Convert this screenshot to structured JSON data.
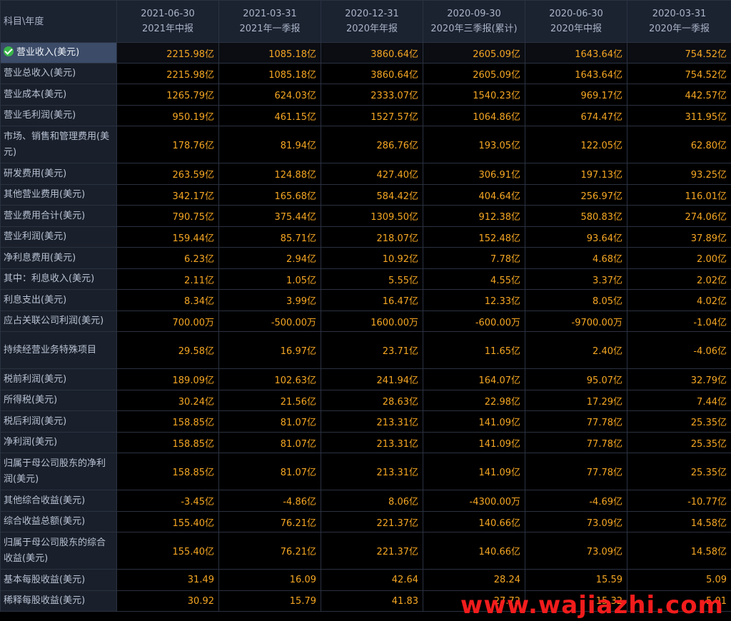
{
  "header": {
    "corner_label": "科目\\年度",
    "columns": [
      {
        "date": "2021-06-30",
        "period": "2021年中报"
      },
      {
        "date": "2021-03-31",
        "period": "2021年一季报"
      },
      {
        "date": "2020-12-31",
        "period": "2020年年报"
      },
      {
        "date": "2020-09-30",
        "period": "2020年三季报(累计)"
      },
      {
        "date": "2020-06-30",
        "period": "2020年中报"
      },
      {
        "date": "2020-03-31",
        "period": "2020年一季报"
      }
    ]
  },
  "rows": [
    {
      "label": "营业收入(美元)",
      "values": [
        "2215.98亿",
        "1085.18亿",
        "3860.64亿",
        "2605.09亿",
        "1643.64亿",
        "754.52亿"
      ]
    },
    {
      "label": "营业总收入(美元)",
      "values": [
        "2215.98亿",
        "1085.18亿",
        "3860.64亿",
        "2605.09亿",
        "1643.64亿",
        "754.52亿"
      ]
    },
    {
      "label": "营业成本(美元)",
      "values": [
        "1265.79亿",
        "624.03亿",
        "2333.07亿",
        "1540.23亿",
        "969.17亿",
        "442.57亿"
      ]
    },
    {
      "label": "营业毛利润(美元)",
      "values": [
        "950.19亿",
        "461.15亿",
        "1527.57亿",
        "1064.86亿",
        "674.47亿",
        "311.95亿"
      ]
    },
    {
      "label": "市场、销售和管理费用(美元)",
      "values": [
        "178.76亿",
        "81.94亿",
        "286.76亿",
        "193.05亿",
        "122.05亿",
        "62.80亿"
      ]
    },
    {
      "label": "研发费用(美元)",
      "values": [
        "263.59亿",
        "124.88亿",
        "427.40亿",
        "306.91亿",
        "197.13亿",
        "93.25亿"
      ]
    },
    {
      "label": "其他营业费用(美元)",
      "values": [
        "342.17亿",
        "165.68亿",
        "584.42亿",
        "404.64亿",
        "256.97亿",
        "116.01亿"
      ]
    },
    {
      "label": "营业费用合计(美元)",
      "values": [
        "790.75亿",
        "375.44亿",
        "1309.50亿",
        "912.38亿",
        "580.83亿",
        "274.06亿"
      ]
    },
    {
      "label": "营业利润(美元)",
      "values": [
        "159.44亿",
        "85.71亿",
        "218.07亿",
        "152.48亿",
        "93.64亿",
        "37.89亿"
      ]
    },
    {
      "label": "净利息费用(美元)",
      "values": [
        "6.23亿",
        "2.94亿",
        "10.92亿",
        "7.78亿",
        "4.68亿",
        "2.00亿"
      ]
    },
    {
      "label": "其中：利息收入(美元)",
      "values": [
        "2.11亿",
        "1.05亿",
        "5.55亿",
        "4.55亿",
        "3.37亿",
        "2.02亿"
      ]
    },
    {
      "label": "利息支出(美元)",
      "values": [
        "8.34亿",
        "3.99亿",
        "16.47亿",
        "12.33亿",
        "8.05亿",
        "4.02亿"
      ]
    },
    {
      "label": "应占关联公司利润(美元)",
      "values": [
        "700.00万",
        "-500.00万",
        "1600.00万",
        "-600.00万",
        "-9700.00万",
        "-1.04亿"
      ]
    },
    {
      "label": "持续经营业务特殊项目",
      "values": [
        "29.58亿",
        "16.97亿",
        "23.71亿",
        "11.65亿",
        "2.40亿",
        "-4.06亿"
      ]
    },
    {
      "label": "税前利润(美元)",
      "values": [
        "189.09亿",
        "102.63亿",
        "241.94亿",
        "164.07亿",
        "95.07亿",
        "32.79亿"
      ]
    },
    {
      "label": "所得税(美元)",
      "values": [
        "30.24亿",
        "21.56亿",
        "28.63亿",
        "22.98亿",
        "17.29亿",
        "7.44亿"
      ]
    },
    {
      "label": "税后利润(美元)",
      "values": [
        "158.85亿",
        "81.07亿",
        "213.31亿",
        "141.09亿",
        "77.78亿",
        "25.35亿"
      ]
    },
    {
      "label": "净利润(美元)",
      "values": [
        "158.85亿",
        "81.07亿",
        "213.31亿",
        "141.09亿",
        "77.78亿",
        "25.35亿"
      ]
    },
    {
      "label": "归属于母公司股东的净利润(美元)",
      "values": [
        "158.85亿",
        "81.07亿",
        "213.31亿",
        "141.09亿",
        "77.78亿",
        "25.35亿"
      ]
    },
    {
      "label": "其他综合收益(美元)",
      "values": [
        "-3.45亿",
        "-4.86亿",
        "8.06亿",
        "-4300.00万",
        "-4.69亿",
        "-10.77亿"
      ]
    },
    {
      "label": "综合收益总额(美元)",
      "values": [
        "155.40亿",
        "76.21亿",
        "221.37亿",
        "140.66亿",
        "73.09亿",
        "14.58亿"
      ]
    },
    {
      "label": "归属于母公司股东的综合收益(美元)",
      "values": [
        "155.40亿",
        "76.21亿",
        "221.37亿",
        "140.66亿",
        "73.09亿",
        "14.58亿"
      ]
    },
    {
      "label": "基本每股收益(美元)",
      "values": [
        "31.49",
        "16.09",
        "42.64",
        "28.24",
        "15.59",
        "5.09"
      ]
    },
    {
      "label": "稀释每股收益(美元)",
      "values": [
        "30.92",
        "15.79",
        "41.83",
        "27.72",
        "15.32",
        "5.01"
      ]
    }
  ],
  "watermark": "www.wajiazhi.com",
  "colors": {
    "value": "#f5a623",
    "label": "#b7c1d3",
    "selected_row": "#3b4b68",
    "check": "#39b54a",
    "watermark": "#ff1e1e"
  },
  "icons": {
    "selected_row_marker": "check-circle-icon"
  }
}
